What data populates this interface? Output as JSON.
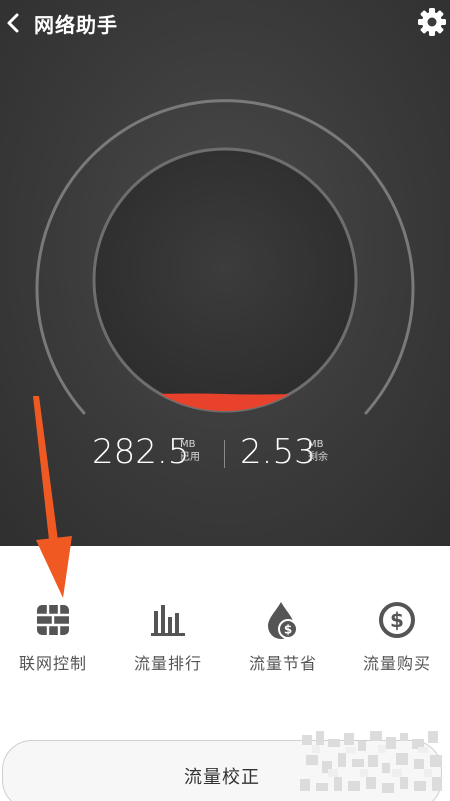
{
  "header": {
    "title": "网络助手",
    "back_icon": "chevron-left-icon",
    "settings_icon": "gear-icon"
  },
  "gauge": {
    "used_fraction": 0.02,
    "accent_color": "#e8412c",
    "ring_color": "#7a7a7a"
  },
  "stats": {
    "used_value": "282.5",
    "used_unit": "MB",
    "used_label": "已用",
    "remaining_value": "2.53",
    "remaining_unit": "MB",
    "remaining_label": "剩余"
  },
  "menu": {
    "items": [
      {
        "label": "联网控制",
        "icon": "firewall-icon"
      },
      {
        "label": "流量排行",
        "icon": "bar-chart-icon"
      },
      {
        "label": "流量节省",
        "icon": "save-money-drop-icon"
      },
      {
        "label": "流量购买",
        "icon": "dollar-circle-icon"
      }
    ]
  },
  "calibrate": {
    "label": "流量校正"
  },
  "colors": {
    "dark_bg": "#3a3a3a",
    "arrow": "#f05a22",
    "icon": "#555555"
  }
}
